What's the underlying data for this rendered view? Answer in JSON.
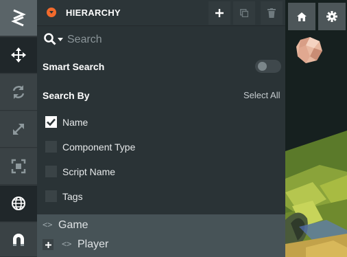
{
  "toolbar": {
    "tools": [
      {
        "name": "logo",
        "icon": "logo-chevron-icon"
      },
      {
        "name": "move",
        "icon": "move-arrows-icon"
      },
      {
        "name": "rotate",
        "icon": "rotate-icon"
      },
      {
        "name": "scale",
        "icon": "scale-diagonal-icon"
      },
      {
        "name": "rect",
        "icon": "rect-transform-icon"
      },
      {
        "name": "world",
        "icon": "globe-icon"
      },
      {
        "name": "snap",
        "icon": "magnet-icon"
      }
    ]
  },
  "hierarchy": {
    "title": "HIERARCHY",
    "search": {
      "placeholder": "Search"
    },
    "smart_search": {
      "label": "Smart Search",
      "enabled": false
    },
    "search_by": {
      "label": "Search By",
      "select_all": "Select All",
      "options": [
        {
          "label": "Name",
          "checked": true
        },
        {
          "label": "Component Type",
          "checked": false
        },
        {
          "label": "Script Name",
          "checked": false
        },
        {
          "label": "Tags",
          "checked": false
        }
      ]
    },
    "tree": [
      {
        "label": "Game",
        "code_icon": "<>"
      },
      {
        "label": "Player",
        "code_icon": "<>"
      }
    ]
  },
  "colors": {
    "accent": "#f26a2c",
    "panel_bg": "#2a3336",
    "toolbar_active": "#20272a",
    "tree_bg": "#475357"
  }
}
